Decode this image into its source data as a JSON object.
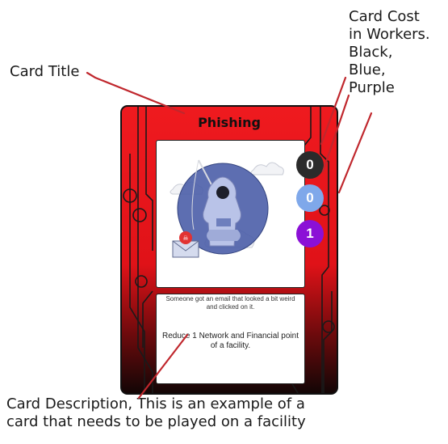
{
  "annotations": {
    "card_title_label": "Card Title",
    "cost_label_lines": [
      "Card Cost",
      "in Workers.",
      "Black,",
      "Blue,",
      "Purple"
    ],
    "description_label_lines": [
      "Card Description, This is an example of a",
      "card that needs to be played on a facility"
    ]
  },
  "card": {
    "title": "Phishing",
    "flavor_text": "Someone got an email that looked a bit weird and clicked on it.",
    "effect_text": "Reduce 1 Network and Financial point of a facility.",
    "illustration_icons": [
      "hooded-hacker-fishing-icon",
      "email-envelope-icon",
      "cloud-icon"
    ],
    "costs": [
      {
        "worker": "black",
        "value": "0",
        "color": "#2b2b2b"
      },
      {
        "worker": "blue",
        "value": "0",
        "color": "#7fa8ea"
      },
      {
        "worker": "purple",
        "value": "1",
        "color": "#8b10d6"
      }
    ]
  },
  "colors": {
    "card_red": "#e8151b",
    "card_dark": "#1a0b0b",
    "pointer_line": "#c0272d"
  }
}
